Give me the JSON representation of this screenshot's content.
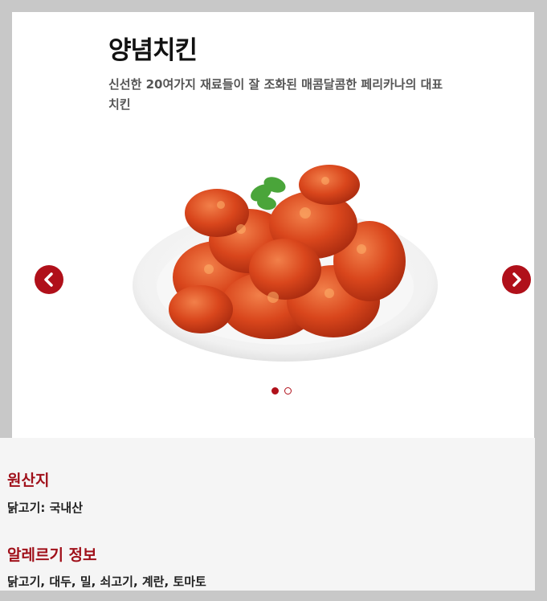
{
  "product": {
    "name": "양념치킨",
    "description": "신선한 20여가지 재료들이 잘 조화된 매콤달콤한 페리카나의 대표 치킨"
  },
  "carousel": {
    "prev_icon": "chevron-left-icon",
    "next_icon": "chevron-right-icon",
    "slide_count": 2,
    "active_slide": 1
  },
  "info": {
    "origin_title": "원산지",
    "origin_text": "닭고기: 국내산",
    "allergy_title": "알레르기 정보",
    "allergy_text": "닭고기, 대두, 밀, 쇠고기, 계란, 토마토"
  },
  "colors": {
    "accent": "#b0101a",
    "background": "#c8c8c8",
    "panel": "#f5f5f5"
  }
}
